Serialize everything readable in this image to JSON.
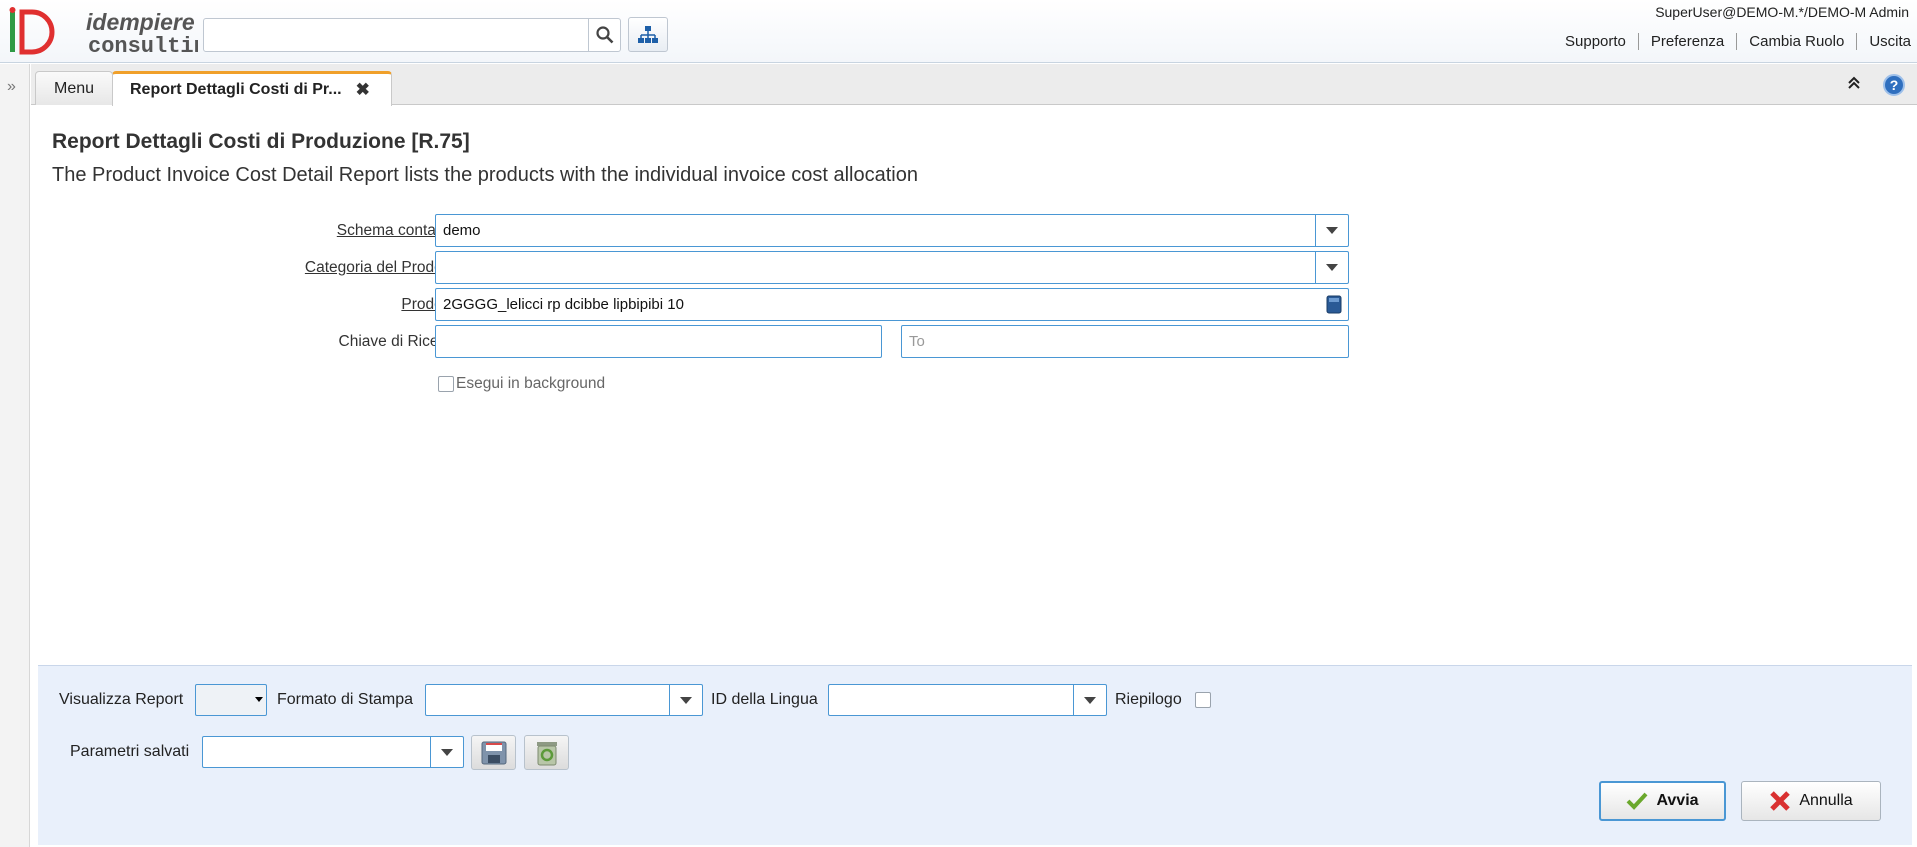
{
  "header": {
    "logo_text_top": "idempiere",
    "logo_text_bottom": "consulting",
    "search_value": "",
    "user_info": "SuperUser@DEMO-M.*/DEMO-M Admin",
    "links": [
      "Supporto",
      "Preferenza",
      "Cambia Ruolo",
      "Uscita"
    ]
  },
  "tabs": {
    "menu_label": "Menu",
    "active_label": "Report Dettagli Costi di Pr...",
    "close_symbol": "✖"
  },
  "form": {
    "title": "Report Dettagli Costi di Produzione [R.75]",
    "description": "The Product Invoice Cost Detail Report lists the products with the individual invoice cost allocation",
    "fields": {
      "schema_label": "Schema contabile",
      "schema_value": "demo",
      "categoria_label": "Categoria del Prodotto",
      "categoria_value": "",
      "prodotto_label": "Prodotto",
      "prodotto_value": "2GGGG_lelicci rp dcibbe lipbipibi 10",
      "chiave_label": "Chiave di Ricerca",
      "chiave_value": "",
      "chiave_to_placeholder": "To"
    },
    "background_label": "Esegui in background",
    "background_checked": false
  },
  "south": {
    "visualizza_label": "Visualizza Report",
    "formato_label": "Formato di Stampa",
    "lingua_label": "ID della Lingua",
    "riepilogo_label": "Riepilogo",
    "parametri_label": "Parametri salvati",
    "ok_label": "Avvia",
    "cancel_label": "Annulla"
  },
  "colors": {
    "accent_blue": "#4a97d4",
    "tab_orange": "#f0a02a",
    "panel_bg": "#e9f0fb"
  }
}
